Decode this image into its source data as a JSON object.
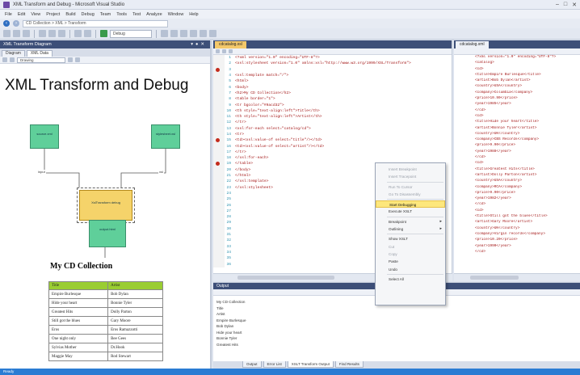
{
  "window": {
    "title": "XML Transform and Debug - Microsoft Visual Studio"
  },
  "menu": [
    "File",
    "Edit",
    "View",
    "Project",
    "Build",
    "Debug",
    "Team",
    "Tools",
    "Test",
    "Analyze",
    "Window",
    "Help"
  ],
  "address": {
    "crumbs": "CD Collection > XML > Transform"
  },
  "toolbar": {
    "combo": "Debug"
  },
  "left_panel": {
    "header": "XML Transform Diagram",
    "tabs": [
      "Diagram",
      "XML Data"
    ],
    "combo": "Drawing",
    "doc_title": "XML Transform and Debug",
    "nodes": {
      "source_xml": "source.xml",
      "stylesheet": "stylesheet.xsl",
      "transform": "XslTransform debug",
      "output_html": "output.html"
    },
    "edge_labels": {
      "left": "input",
      "right": "xsl",
      "bottom": "output"
    },
    "cd_heading": "My CD Collection",
    "table": {
      "headers": [
        "Title",
        "Artist"
      ],
      "rows": [
        [
          "Empire Burlesque",
          "Bob Dylan"
        ],
        [
          "Hide your heart",
          "Bonnie Tyler"
        ],
        [
          "Greatest Hits",
          "Dolly Parton"
        ],
        [
          "Still got the blues",
          "Gary Moore"
        ],
        [
          "Eros",
          "Eros Ramazzotti"
        ],
        [
          "One night only",
          "Bee Gees"
        ],
        [
          "Sylvias Mother",
          "Dr.Hook"
        ],
        [
          "Maggie May",
          "Rod Stewart"
        ]
      ]
    }
  },
  "editor": {
    "tab": "cdcatalog.xsl",
    "lines": [
      "<?xml version=\"1.0\" encoding=\"UTF-8\"?>",
      "<xsl:stylesheet version=\"1.0\" xmlns:xsl=\"http://www.w3.org/1999/XSL/Transform\">",
      "",
      "<xsl:template match=\"/\">",
      "  <html>",
      "  <body>",
      "  <h2>My CD Collection</h2>",
      "    <table border=\"1\">",
      "      <tr bgcolor=\"#9acd32\">",
      "        <th style=\"text-align:left\">Title</th>",
      "        <th style=\"text-align:left\">Artist</th>",
      "      </tr>",
      "      <xsl:for-each select=\"catalog/cd\">",
      "      <tr>",
      "        <td><xsl:value-of select=\"title\"/></td>",
      "        <td><xsl:value-of select=\"artist\"/></td>",
      "      </tr>",
      "      </xsl:for-each>",
      "    </table>",
      "  </body>",
      "  </html>",
      "</xsl:template>",
      "</xsl:stylesheet>",
      "",
      "",
      "",
      "",
      "",
      "",
      "",
      "",
      "",
      "",
      "",
      "",
      ""
    ],
    "breakpoints": [
      2,
      14,
      18
    ]
  },
  "editor2": {
    "tab": "cdcatalog.xml",
    "lines": [
      "<?xml version=\"1.0\" encoding=\"UTF-8\"?>",
      "<catalog>",
      "  <cd>",
      "    <title>Empire Burlesque</title>",
      "    <artist>Bob Dylan</artist>",
      "    <country>USA</country>",
      "    <company>Columbia</company>",
      "    <price>10.90</price>",
      "    <year>1985</year>",
      "  </cd>",
      "  <cd>",
      "    <title>Hide your heart</title>",
      "    <artist>Bonnie Tyler</artist>",
      "    <country>UK</country>",
      "    <company>CBS Records</company>",
      "    <price>9.90</price>",
      "    <year>1988</year>",
      "  </cd>",
      "  <cd>",
      "    <title>Greatest Hits</title>",
      "    <artist>Dolly Parton</artist>",
      "    <country>USA</country>",
      "    <company>RCA</company>",
      "    <price>9.90</price>",
      "    <year>1982</year>",
      "  </cd>",
      "  <cd>",
      "    <title>Still got the blues</title>",
      "    <artist>Gary Moore</artist>",
      "    <country>UK</country>",
      "    <company>Virgin records</company>",
      "    <price>10.20</price>",
      "    <year>1990</year>",
      "  </cd>",
      "",
      ""
    ]
  },
  "context_menu": {
    "items": [
      {
        "label": "Insert Breakpoint",
        "state": "disabled"
      },
      {
        "label": "Insert Tracepoint",
        "state": "disabled"
      },
      {
        "label": "",
        "state": "sep"
      },
      {
        "label": "Run To Cursor",
        "state": "disabled"
      },
      {
        "label": "Go To Disassembly",
        "state": "disabled"
      },
      {
        "label": "",
        "state": "sep"
      },
      {
        "label": "Start Debugging",
        "state": "highlight"
      },
      {
        "label": "Execute XSLT",
        "state": "normal"
      },
      {
        "label": "",
        "state": "sep"
      },
      {
        "label": "Breakpoint",
        "state": "submenu"
      },
      {
        "label": "Outlining",
        "state": "submenu"
      },
      {
        "label": "",
        "state": "sep"
      },
      {
        "label": "Show XSLT",
        "state": "normal"
      },
      {
        "label": "Cut",
        "state": "disabled"
      },
      {
        "label": "Copy",
        "state": "disabled"
      },
      {
        "label": "Paste",
        "state": "normal"
      },
      {
        "label": "Undo",
        "state": "normal"
      },
      {
        "label": "",
        "state": "sep"
      },
      {
        "label": "Select All",
        "state": "normal"
      }
    ]
  },
  "output": {
    "header": "Output",
    "lines": [
      "My CD Collection",
      "Title",
      "Artist",
      "Empire Burlesque",
      "Bob Dylan",
      "Hide your heart",
      "Bonnie Tyler",
      "Greatest Hits"
    ],
    "tabs": [
      "Output",
      "Error List",
      "XSLT Transform Output",
      "Find Results"
    ]
  },
  "statusbar": {
    "text": "Ready"
  }
}
